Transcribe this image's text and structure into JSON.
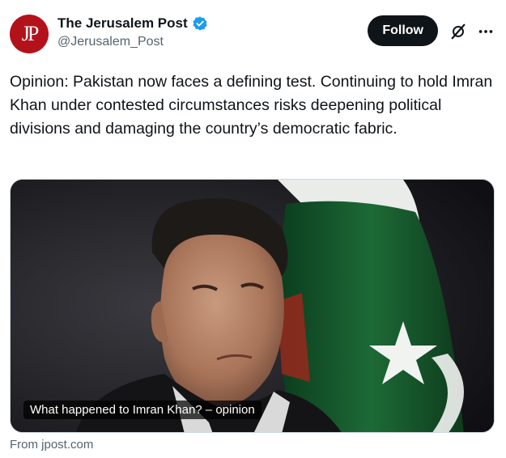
{
  "account": {
    "name": "The Jerusalem Post",
    "handle": "@Jerusalem_Post",
    "avatar_text": "JP",
    "verified": true,
    "brand_color": "#b3121b",
    "verified_color": "#1d9bf0"
  },
  "actions": {
    "follow_label": "Follow",
    "grok_icon": "grok-icon",
    "more_icon": "more-icon"
  },
  "tweet": {
    "text": "Opinion: Pakistan now faces a defining test. Continuing to hold Imran Khan under contested circumstances risks deepening political divisions and damaging the country’s democratic fabric."
  },
  "card": {
    "caption": "What happened to Imran Khan? – opinion",
    "source": "From jpost.com"
  }
}
